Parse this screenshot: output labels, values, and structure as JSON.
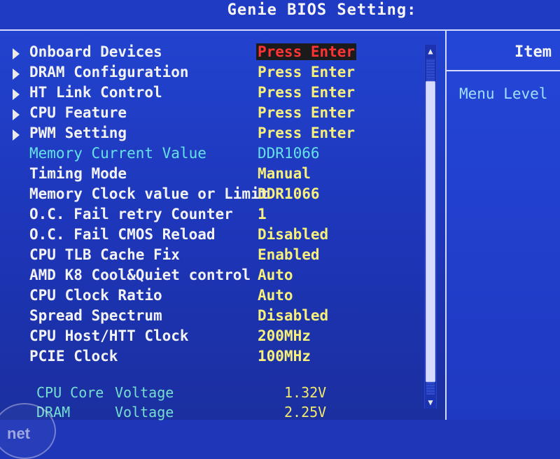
{
  "window": {
    "title": "Genie BIOS Setting:"
  },
  "menu": {
    "rows": [
      {
        "label": "Onboard Devices",
        "value": "Press Enter",
        "kind": "submenu",
        "selected": true
      },
      {
        "label": "DRAM Configuration",
        "value": "Press Enter",
        "kind": "submenu"
      },
      {
        "label": "HT Link Control",
        "value": "Press Enter",
        "kind": "submenu"
      },
      {
        "label": "CPU Feature",
        "value": "Press Enter",
        "kind": "submenu"
      },
      {
        "label": "PWM Setting",
        "value": "Press Enter",
        "kind": "submenu"
      },
      {
        "label": "Memory  Current Value",
        "value": "DDR1066",
        "kind": "info"
      },
      {
        "label": "Timing Mode",
        "value": "Manual",
        "kind": "setting"
      },
      {
        "label": "Memory Clock value or Limit",
        "value": "DDR1066",
        "kind": "setting"
      },
      {
        "label": "O.C. Fail retry Counter",
        "value": "1",
        "kind": "setting"
      },
      {
        "label": "O.C. Fail CMOS Reload",
        "value": "Disabled",
        "kind": "setting"
      },
      {
        "label": "CPU TLB Cache Fix",
        "value": "Enabled",
        "kind": "setting"
      },
      {
        "label": "AMD K8 Cool&Quiet control",
        "value": "Auto",
        "kind": "setting"
      },
      {
        "label": "CPU Clock Ratio",
        "value": "Auto",
        "kind": "setting"
      },
      {
        "label": "Spread Spectrum",
        "value": "Disabled",
        "kind": "setting"
      },
      {
        "label": "CPU Host/HTT Clock",
        "value": "200MHz",
        "kind": "setting"
      },
      {
        "label": "PCIE Clock",
        "value": "100MHz",
        "kind": "setting"
      }
    ]
  },
  "voltages": [
    {
      "name": "CPU Core",
      "label": "Voltage",
      "value": "1.32V"
    },
    {
      "name": "DRAM",
      "label": "Voltage",
      "value": "2.25V"
    }
  ],
  "help_panel": {
    "header": "Item",
    "menu_level_label": "Menu Level"
  },
  "watermark": {
    "text": "net"
  },
  "colors": {
    "background": "#1f36b8",
    "selected_value_text": "#ff3333",
    "value_text": "#f7f07a",
    "info_text": "#66e2e7"
  }
}
